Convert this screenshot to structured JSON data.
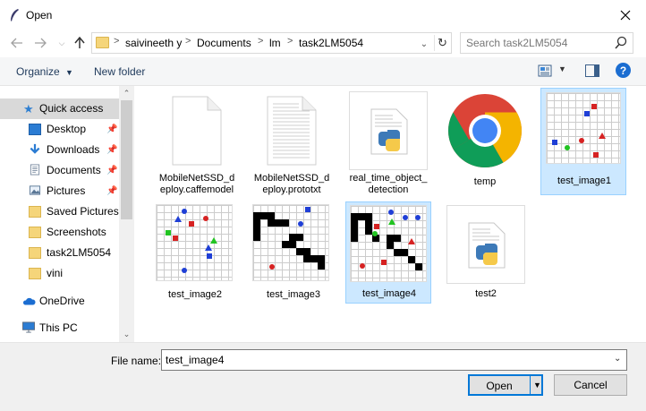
{
  "window": {
    "title": "Open"
  },
  "address": {
    "crumbs": [
      "saivineeth y",
      "Documents",
      "lm",
      "task2LM5054"
    ]
  },
  "search": {
    "placeholder": "Search task2LM5054"
  },
  "toolbar": {
    "organize": "Organize",
    "new_folder": "New folder"
  },
  "sidebar": {
    "items": [
      {
        "label": "Quick access",
        "icon": "star-icon"
      },
      {
        "label": "Desktop",
        "icon": "desktop-icon",
        "pinned": true
      },
      {
        "label": "Downloads",
        "icon": "download-icon",
        "pinned": true
      },
      {
        "label": "Documents",
        "icon": "document-icon",
        "pinned": true
      },
      {
        "label": "Pictures",
        "icon": "pictures-icon",
        "pinned": true
      },
      {
        "label": "Saved Pictures",
        "icon": "folder-icon"
      },
      {
        "label": "Screenshots",
        "icon": "folder-icon"
      },
      {
        "label": "task2LM5054",
        "icon": "folder-icon"
      },
      {
        "label": "vini",
        "icon": "folder-icon"
      },
      {
        "label": "OneDrive",
        "icon": "cloud-icon"
      },
      {
        "label": "This PC",
        "icon": "computer-icon"
      }
    ]
  },
  "files": [
    {
      "name": "MobileNetSSD_deploy.caffemodel",
      "line1": "MobileNetSSD_d",
      "line2": "eploy.caffemodel",
      "icon": "blank-file-icon"
    },
    {
      "name": "MobileNetSSD_deploy.prototxt",
      "line1": "MobileNetSSD_d",
      "line2": "eploy.prototxt",
      "icon": "text-file-icon"
    },
    {
      "name": "real_time_object_detection",
      "line1": "real_time_object_",
      "line2": "detection",
      "icon": "python-file-icon"
    },
    {
      "name": "temp",
      "line1": "temp",
      "line2": "",
      "icon": "chrome-icon"
    },
    {
      "name": "test_image1",
      "line1": "test_image1",
      "line2": "",
      "icon": "image-thumbnail"
    },
    {
      "name": "test_image2",
      "line1": "test_image2",
      "line2": "",
      "icon": "image-thumbnail"
    },
    {
      "name": "test_image3",
      "line1": "test_image3",
      "line2": "",
      "icon": "image-thumbnail"
    },
    {
      "name": "test_image4",
      "line1": "test_image4",
      "line2": "",
      "icon": "image-thumbnail"
    },
    {
      "name": "test2",
      "line1": "test2",
      "line2": "",
      "icon": "python-file-icon"
    }
  ],
  "bottom": {
    "file_name_label": "File name:",
    "file_name_value": "test_image4",
    "open": "Open",
    "cancel": "Cancel"
  },
  "colors": {
    "selection": "#cce8ff",
    "accent": "#0078d7",
    "folder": "#f5d57a"
  }
}
